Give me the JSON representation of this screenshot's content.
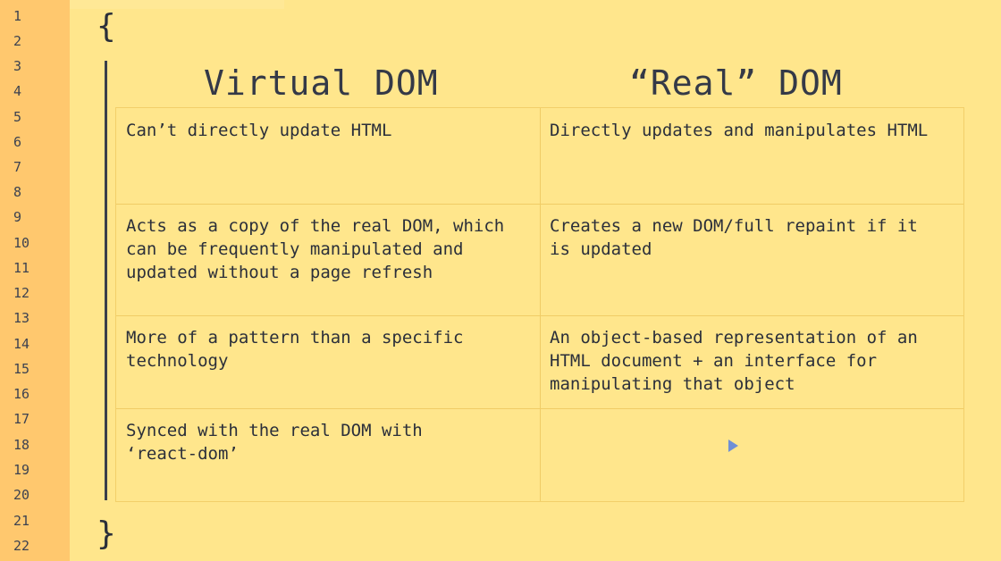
{
  "line_numbers": [
    "1",
    "2",
    "3",
    "4",
    "5",
    "6",
    "7",
    "8",
    "9",
    "10",
    "11",
    "12",
    "13",
    "14",
    "15",
    "16",
    "17",
    "18",
    "19",
    "20",
    "21",
    "22"
  ],
  "braces": {
    "open": "{",
    "close": "}"
  },
  "headings": {
    "left": "Virtual DOM",
    "right": "“Real” DOM"
  },
  "rows": [
    {
      "left": "Can’t directly update HTML",
      "right": "Directly updates and manipulates HTML"
    },
    {
      "left": "Acts as a copy of the real DOM, which\ncan be frequently manipulated and\nupdated without a page refresh",
      "right": "Creates a new DOM/full repaint if it\nis updated"
    },
    {
      "left": "More of a pattern than a specific\ntechnology",
      "right": "An object-based representation of an\nHTML document + an interface for\nmanipulating that object"
    },
    {
      "left": "Synced with the real DOM with\n‘react-dom’",
      "right": ""
    }
  ],
  "icons": {
    "cursor": "mouse-pointer-icon"
  },
  "colors": {
    "background": "#ffe589",
    "gutter": "#ffc86e",
    "text": "#2b2f3a"
  }
}
